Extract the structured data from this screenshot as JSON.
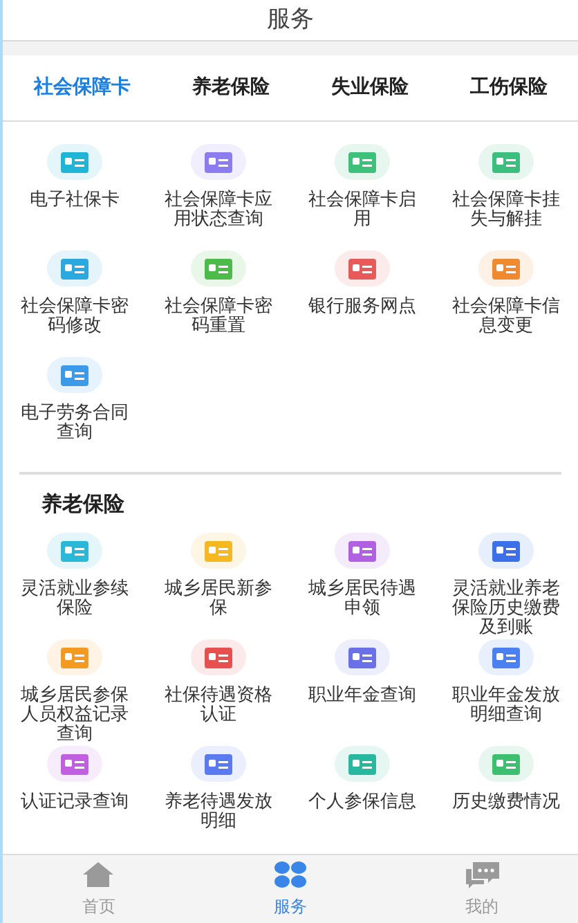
{
  "header": {
    "title": "服务"
  },
  "tabs": [
    {
      "label": "社会保障卡",
      "selected": true
    },
    {
      "label": "养老保险",
      "selected": false
    },
    {
      "label": "失业保险",
      "selected": false
    },
    {
      "label": "工伤保险",
      "selected": false
    }
  ],
  "sections": [
    {
      "items": [
        {
          "label": "电子社保卡",
          "color": "#1fb5d6"
        },
        {
          "label": "社会保障卡应用状态查询",
          "color": "#8b7cf0"
        },
        {
          "label": "社会保障卡启用",
          "color": "#3cc07a"
        },
        {
          "label": "社会保障卡挂失与解挂",
          "color": "#3cbf7e"
        },
        {
          "label": "社会保障卡密码修改",
          "color": "#2aa8e0"
        },
        {
          "label": "社会保障卡密码重置",
          "color": "#4cbb4a"
        },
        {
          "label": "银行服务网点",
          "color": "#e85a5a"
        },
        {
          "label": "社会保障卡信息变更",
          "color": "#f08a30"
        },
        {
          "label": "电子劳务合同查询",
          "color": "#3c9be8"
        }
      ]
    },
    {
      "title": "养老保险",
      "items": [
        {
          "label": "灵活就业参续保险",
          "color": "#2ab8d8"
        },
        {
          "label": "城乡居民新参保",
          "color": "#f5b820"
        },
        {
          "label": "城乡居民待遇申领",
          "color": "#b060e0"
        },
        {
          "label": "灵活就业养老保险历史缴费及到账",
          "color": "#3c70e8"
        },
        {
          "label": "城乡居民参保人员权益记录查询",
          "color": "#f59a20"
        },
        {
          "label": "社保待遇资格认证",
          "color": "#e85050"
        },
        {
          "label": "职业年金查询",
          "color": "#6a70e8"
        },
        {
          "label": "职业年金发放明细查询",
          "color": "#4a80f0"
        },
        {
          "label": "认证记录查询",
          "color": "#c060e0"
        },
        {
          "label": "养老待遇发放明细",
          "color": "#5a7af0"
        },
        {
          "label": "个人参保信息",
          "color": "#28b8a0"
        },
        {
          "label": "历史缴费情况",
          "color": "#3cc070"
        }
      ]
    }
  ],
  "bottom_nav": [
    {
      "label": "首页",
      "kind": "home",
      "selected": false
    },
    {
      "label": "服务",
      "kind": "services",
      "selected": true
    },
    {
      "label": "我的",
      "kind": "chat",
      "selected": false
    }
  ]
}
